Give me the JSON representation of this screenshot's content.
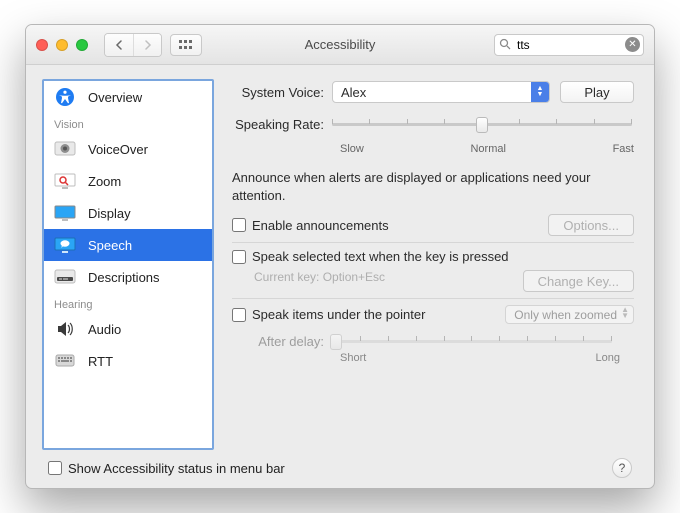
{
  "window": {
    "title": "Accessibility"
  },
  "search": {
    "value": "tts"
  },
  "sidebar": {
    "items": [
      {
        "label": "Overview"
      },
      {
        "label": "VoiceOver"
      },
      {
        "label": "Zoom"
      },
      {
        "label": "Display"
      },
      {
        "label": "Speech"
      },
      {
        "label": "Descriptions"
      },
      {
        "label": "Audio"
      },
      {
        "label": "RTT"
      }
    ],
    "group_vision": "Vision",
    "group_hearing": "Hearing"
  },
  "panel": {
    "system_voice_label": "System Voice:",
    "system_voice_value": "Alex",
    "play_label": "Play",
    "speaking_rate_label": "Speaking Rate:",
    "rate_slow": "Slow",
    "rate_normal": "Normal",
    "rate_fast": "Fast",
    "announce_text": "Announce when alerts are displayed or applications need your attention.",
    "enable_announcements": "Enable announcements",
    "options_label": "Options...",
    "speak_selected": "Speak selected text when the key is pressed",
    "current_key": "Current key: Option+Esc",
    "change_key": "Change Key...",
    "speak_pointer": "Speak items under the pointer",
    "only_when_zoomed": "Only when zoomed",
    "after_delay": "After delay:",
    "delay_short": "Short",
    "delay_long": "Long"
  },
  "footer": {
    "show_status": "Show Accessibility status in menu bar"
  }
}
